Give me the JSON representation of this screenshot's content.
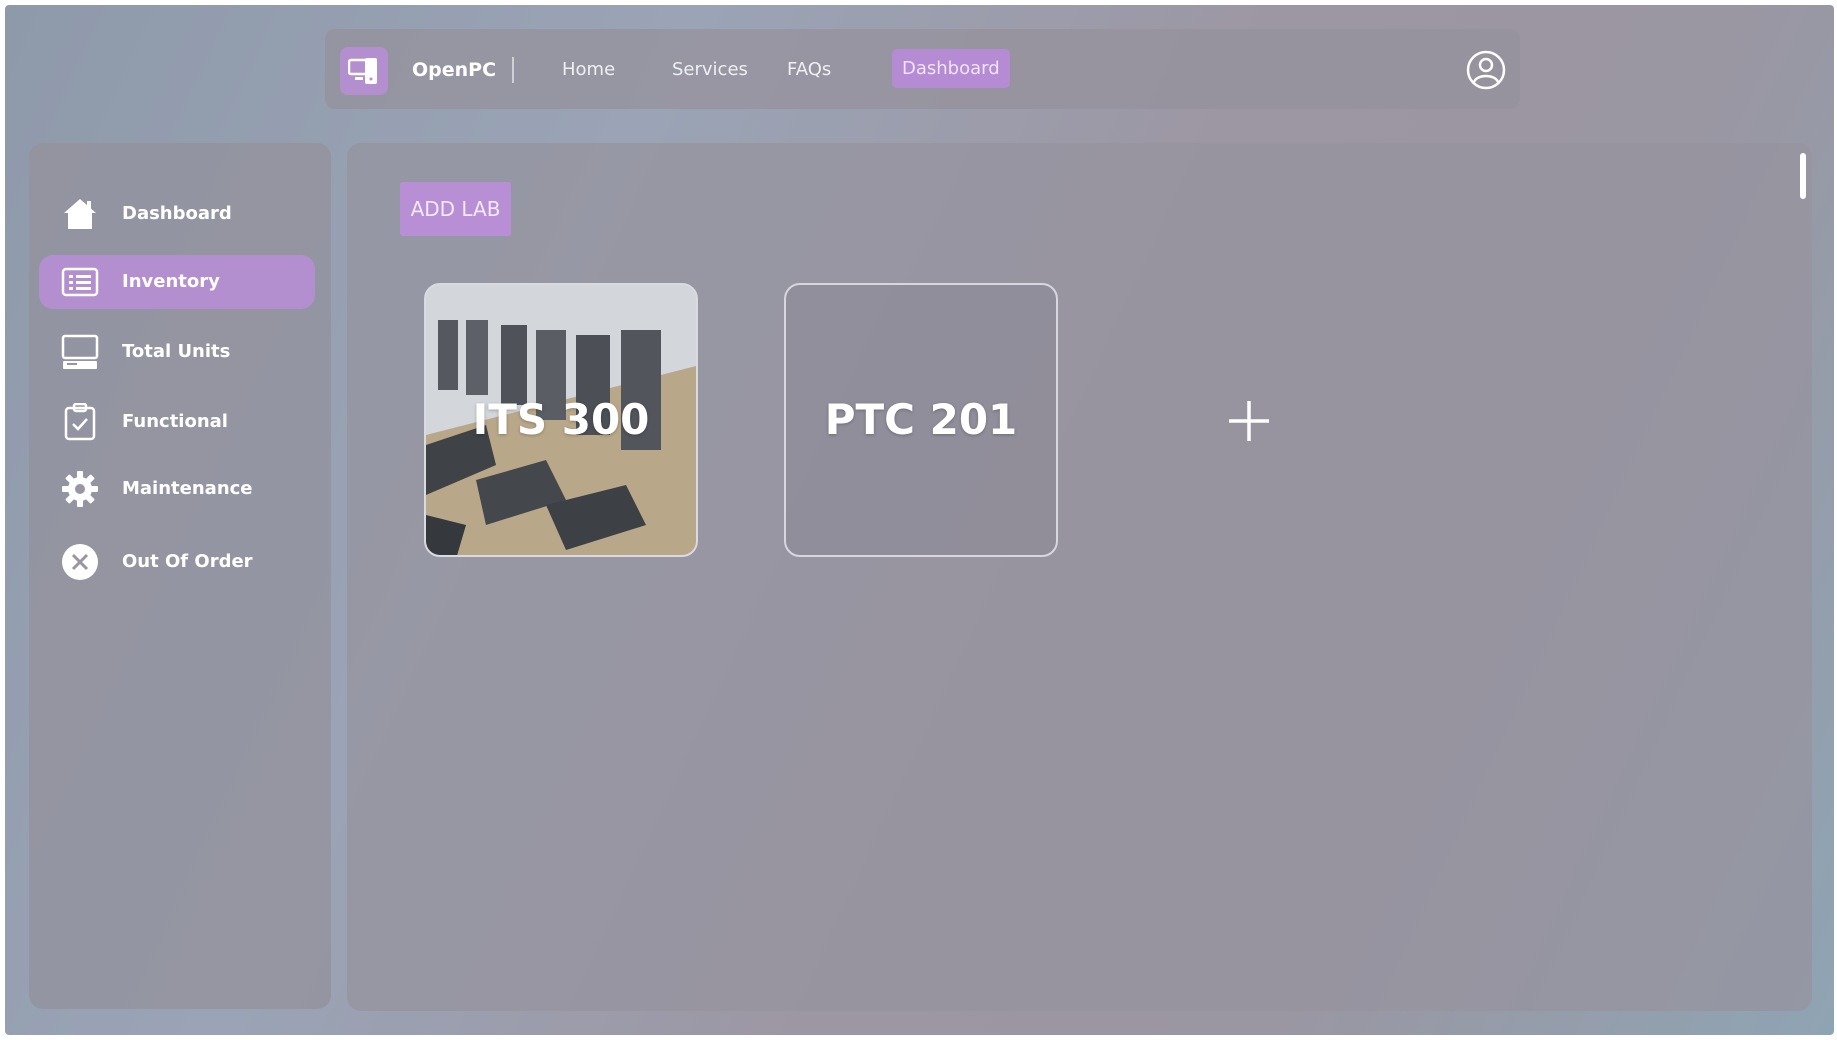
{
  "navbar": {
    "brand": "OpenPC",
    "links": [
      "Home",
      "Services",
      "FAQs",
      "Dashboard"
    ],
    "active": "Dashboard"
  },
  "sidebar": {
    "items": [
      {
        "label": "Dashboard",
        "icon": "home-icon"
      },
      {
        "label": "Inventory",
        "icon": "inventory-icon",
        "active": true
      },
      {
        "label": "Total Units",
        "icon": "computer-icon"
      },
      {
        "label": "Functional",
        "icon": "clipboard-check-icon"
      },
      {
        "label": "Maintenance",
        "icon": "gear-icon"
      },
      {
        "label": "Out Of Order",
        "icon": "x-circle-icon"
      }
    ]
  },
  "main": {
    "add_lab_label": "ADD LAB",
    "labs": [
      {
        "name": "ITS 300",
        "has_photo": true
      },
      {
        "name": "PTC 201",
        "has_photo": false
      }
    ],
    "add_card_icon": "plus-icon"
  },
  "colors": {
    "accent": "#b58cd3",
    "panel": "#96939e"
  }
}
